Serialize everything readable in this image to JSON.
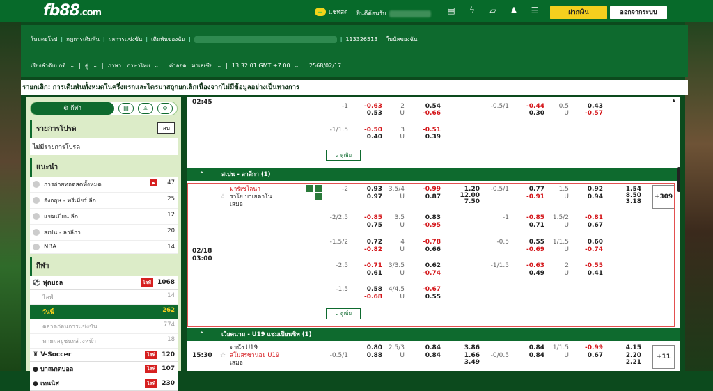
{
  "logo": {
    "main": "fb88",
    "suffix": ".com"
  },
  "topbar": {
    "chat_icon": "chat-icon",
    "chat": "แชทสด",
    "welcome": "ยินดีต้อนรับ",
    "deposit": "ฝากเงิน",
    "logout": "ออกจากระบบ"
  },
  "subheader": {
    "links": [
      "โหมดยุโรป",
      "กฎการเดิมพัน",
      "ผลการแข่งขัน",
      "เดิมพันของฉัน"
    ],
    "account": "113326513",
    "slip": "ใบนัสของฉัน",
    "settings": [
      "เรียงลำดับปกติ",
      "คู่",
      "ภาษา : ภาษาไทย",
      "ค่าออด : มาเลเซีย",
      "13:32:01 GMT +7:00",
      "2568/02/17"
    ]
  },
  "notice": "รายกเลิก: การเดิมพันทั้งหมดในครึ่งแรกและไดรมาสถูกยกเลิกเนื่องจากไม่มีข้อมูลอย่างเป็นทางการ",
  "sidebar": {
    "sport_btn": "กีฬา",
    "my_list_title": "รายการโปรด",
    "clear": "ลบ",
    "my_list_empty": "ไม่มีรายการโปรด",
    "rec_title": "แนะนำ",
    "rec": [
      {
        "name": "การถ่ายทอดสดทั้งหมด",
        "count": "47",
        "live": true
      },
      {
        "name": "อังกฤษ - พรีเมียร์ ลีก",
        "count": "25"
      },
      {
        "name": "แชมเปียน ลีก",
        "count": "12"
      },
      {
        "name": "สเปน - ลาลีกา",
        "count": "20"
      },
      {
        "name": "NBA",
        "count": "14"
      }
    ],
    "sports_title": "กีฬา",
    "live_label": "ไลฟ์",
    "soccer": {
      "name": "ฟุตบอล",
      "count": "1068"
    },
    "soccer_sub": [
      {
        "name": "ไลฟ์",
        "count": "14"
      },
      {
        "name": "วันนี้",
        "count": "262"
      },
      {
        "name": "ตลาดก่อนการแข่งขัน",
        "count": "774"
      },
      {
        "name": "ทายผลยูชนะล่วงหน้า",
        "count": "18"
      }
    ],
    "others": [
      {
        "name": "V-Soccer",
        "count": "120"
      },
      {
        "name": "บาสเกตบอล",
        "count": "107"
      },
      {
        "name": "เทนนิส",
        "count": "230"
      }
    ]
  },
  "top_match": {
    "time": "02:45",
    "more": "ดูเพิ่ม",
    "r1": [
      "-1",
      "-0.63",
      "0.53",
      "2",
      "U",
      "0.54",
      "-0.66",
      "-0.5/1",
      "-0.44",
      "0.30",
      "0.5",
      "U",
      "0.43",
      "-0.57"
    ],
    "r2": [
      "-1/1.5",
      "-0.50",
      "0.40",
      "3",
      "U",
      "-0.51",
      "0.39"
    ]
  },
  "laliga": {
    "header": "สเปน - ลาลีกา (1)",
    "date": "02/18",
    "time": "03:00",
    "home": "มาร์เซโลนา",
    "away": "ราโย บาเยคาโน",
    "draw": "เสมอ",
    "more": "ดูเพิ่ม",
    "plus": "+309",
    "r1": [
      "-2",
      "0.93",
      "0.97",
      "3.5/4",
      "U",
      "-0.99",
      "0.87",
      "1.20",
      "12.00",
      "7.50",
      "-0.5/1",
      "0.77",
      "-0.91",
      "1.5",
      "U",
      "0.92",
      "0.94",
      "1.54",
      "8.50",
      "3.18"
    ],
    "r2": [
      "-2/2.5",
      "-0.85",
      "0.75",
      "3.5",
      "U",
      "0.83",
      "-0.95",
      "-1",
      "-0.85",
      "0.71",
      "1.5/2",
      "U",
      "-0.81",
      "0.67"
    ],
    "r3": [
      "-1.5/2",
      "0.72",
      "-0.82",
      "4",
      "U",
      "-0.78",
      "0.66",
      "-0.5",
      "0.55",
      "-0.69",
      "1/1.5",
      "U",
      "0.60",
      "-0.74"
    ],
    "r4": [
      "-2.5",
      "-0.71",
      "0.61",
      "3/3.5",
      "U",
      "0.62",
      "-0.74",
      "-1/1.5",
      "-0.63",
      "0.49",
      "2",
      "U",
      "-0.55",
      "0.41"
    ],
    "r5": [
      "-1.5",
      "0.58",
      "-0.68",
      "4/4.5",
      "U",
      "-0.67",
      "0.55"
    ]
  },
  "vietnam": {
    "header": "เวียดนาม - U19 แชมเปียนชิพ (1)",
    "time": "15:30",
    "home": "ดานัง U19",
    "away": "สโมสรซานอย U19",
    "draw": "เสมอ",
    "plus": "+11",
    "r1": [
      "-0.5/1",
      "0.80",
      "0.88",
      "2.5/3",
      "U",
      "0.84",
      "0.84",
      "3.86",
      "1.66",
      "3.49",
      "-0/0.5",
      "0.84",
      "0.84",
      "1/1.5",
      "U",
      "-0.99",
      "0.67",
      "4.15",
      "2.20",
      "2.21"
    ]
  },
  "colors": {
    "brand": "#0e6a2e",
    "accent": "#f4cf1e",
    "negative": "#d4161a"
  }
}
